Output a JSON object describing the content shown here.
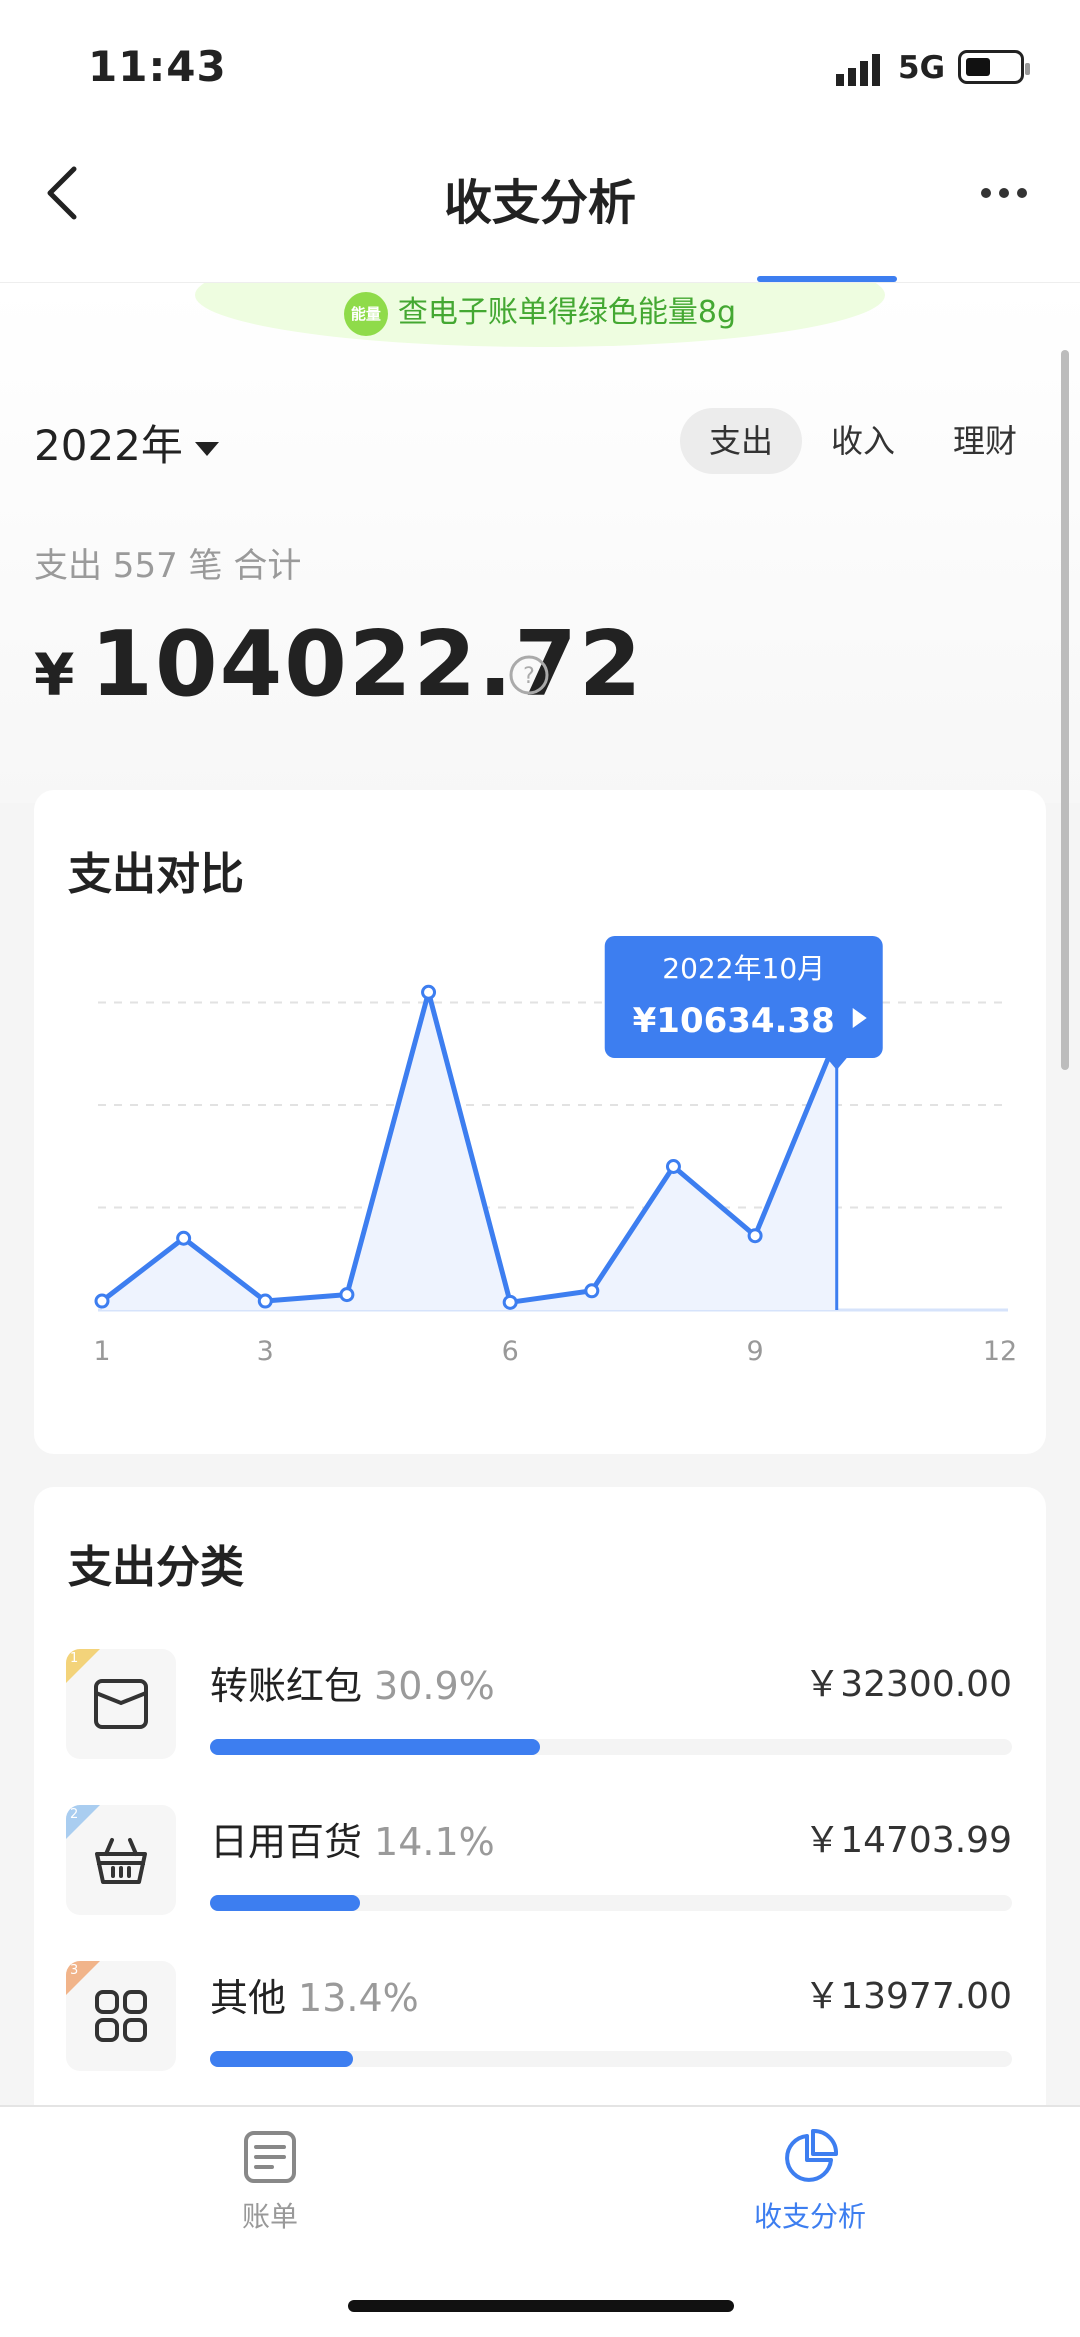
{
  "status": {
    "time": "11:43",
    "network": "5G"
  },
  "nav": {
    "title": "收支分析"
  },
  "banner": {
    "badge": "能量",
    "text": "查电子账单得绿色能量8g"
  },
  "filter": {
    "year": "2022年",
    "tabs": [
      {
        "label": "支出",
        "active": true
      },
      {
        "label": "收入",
        "active": false
      },
      {
        "label": "理财",
        "active": false
      }
    ]
  },
  "summary": {
    "label": "支出 557 笔 合计",
    "currency": "¥",
    "total": "104022.72"
  },
  "chart_card": {
    "title": "支出对比"
  },
  "chart_data": {
    "type": "line",
    "x": [
      1,
      2,
      3,
      4,
      5,
      6,
      7,
      8,
      9,
      10
    ],
    "values": [
      350,
      2800,
      350,
      600,
      12400,
      300,
      750,
      5600,
      2900,
      10634.38
    ],
    "xticks": [
      "1",
      "3",
      "6",
      "9",
      "12"
    ],
    "xtick_values": [
      1,
      3,
      6,
      9,
      12
    ],
    "xlim": [
      1,
      12
    ],
    "ylim": [
      0,
      16000
    ],
    "grid": true,
    "series_color": "#3d7ef0",
    "tooltip": {
      "month_label": "2022年10月",
      "value_label": "¥10634.38",
      "index": 9
    }
  },
  "categories_card": {
    "title": "支出分类",
    "items": [
      {
        "rank": "1",
        "rank_color": "#f3d37a",
        "icon": "wallet-icon",
        "name": "转账红包",
        "pct": "30.9%",
        "amount": "￥32300.00",
        "fraction": 0.309
      },
      {
        "rank": "2",
        "rank_color": "#a9cdf0",
        "icon": "basket-icon",
        "name": "日用百货",
        "pct": "14.1%",
        "amount": "￥14703.99",
        "fraction": 0.141
      },
      {
        "rank": "3",
        "rank_color": "#f1b48a",
        "icon": "grid-icon",
        "name": "其他",
        "pct": "13.4%",
        "amount": "￥13977.00",
        "fraction": 0.134
      }
    ]
  },
  "tabbar": {
    "items": [
      {
        "label": "账单",
        "icon": "bill-icon",
        "active": false
      },
      {
        "label": "收支分析",
        "icon": "pie-chart-icon",
        "active": true
      }
    ]
  },
  "colors": {
    "accent": "#3d7ef0",
    "banner_text": "#44a832"
  }
}
